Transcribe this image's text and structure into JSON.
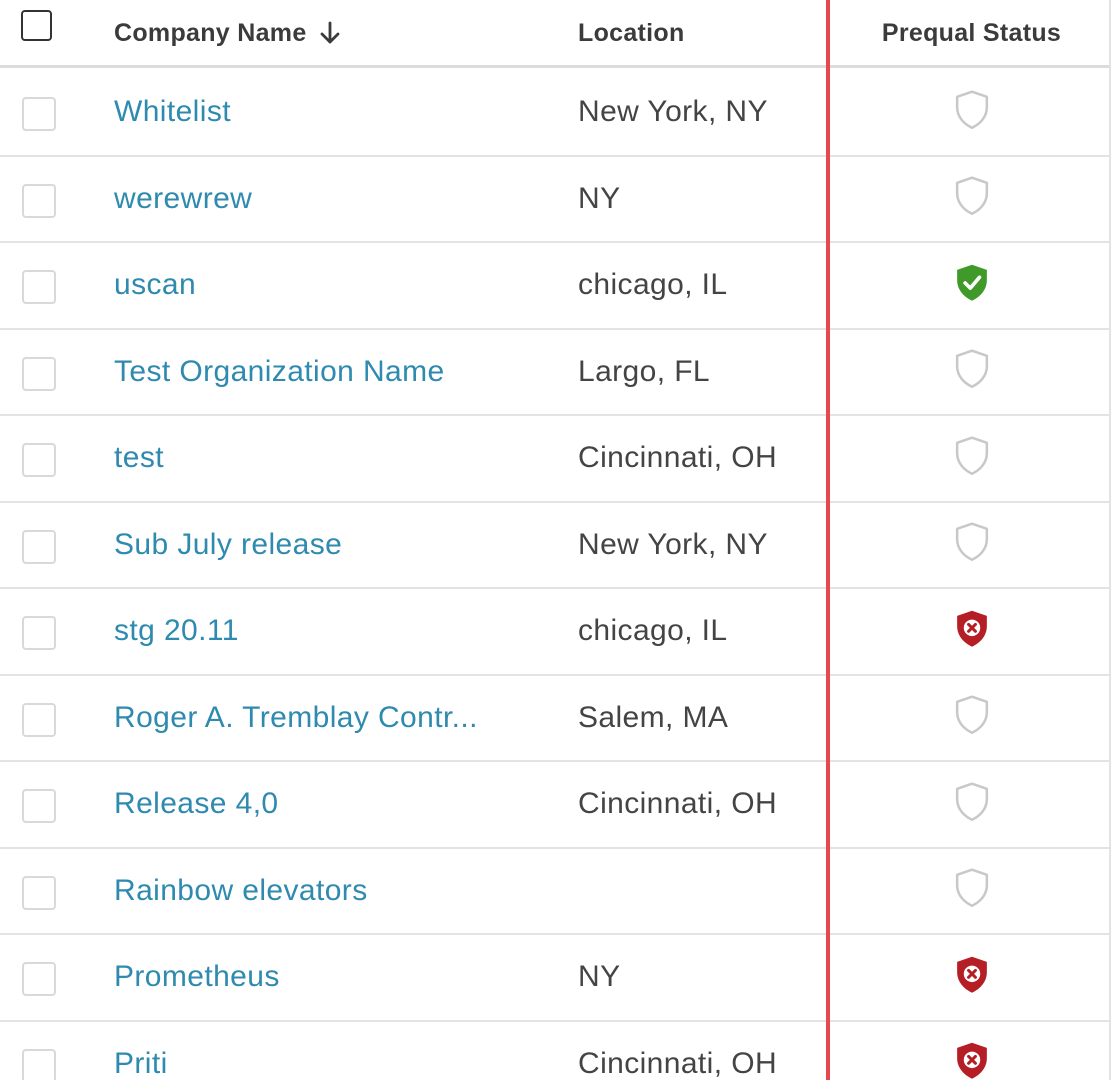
{
  "header": {
    "company_name": "Company Name",
    "location": "Location",
    "prequal_status": "Prequal Status",
    "sort_icon": "arrow-down-icon"
  },
  "colors": {
    "link": "#2e8aae",
    "text": "#444444",
    "divider": "#e8474e",
    "shield_none": "#c8c8c8",
    "shield_approved": "#3f9a2a",
    "shield_rejected": "#b41e24"
  },
  "rows": [
    {
      "company": "Whitelist",
      "location": "New York, NY",
      "status": "none"
    },
    {
      "company": "werewrew",
      "location": "NY",
      "status": "none"
    },
    {
      "company": "uscan",
      "location": "chicago, IL",
      "status": "approved"
    },
    {
      "company": "Test Organization Name",
      "location": "Largo, FL",
      "status": "none"
    },
    {
      "company": "test",
      "location": "Cincinnati, OH",
      "status": "none"
    },
    {
      "company": "Sub July release",
      "location": "New York, NY",
      "status": "none"
    },
    {
      "company": "stg 20.11",
      "location": "chicago, IL",
      "status": "rejected"
    },
    {
      "company": "Roger A. Tremblay Contr...",
      "location": "Salem, MA",
      "status": "none"
    },
    {
      "company": "Release 4,0",
      "location": "Cincinnati, OH",
      "status": "none"
    },
    {
      "company": "Rainbow elevators",
      "location": "",
      "status": "none"
    },
    {
      "company": "Prometheus",
      "location": "NY",
      "status": "rejected"
    },
    {
      "company": "Priti",
      "location": "Cincinnati, OH",
      "status": "rejected"
    }
  ]
}
